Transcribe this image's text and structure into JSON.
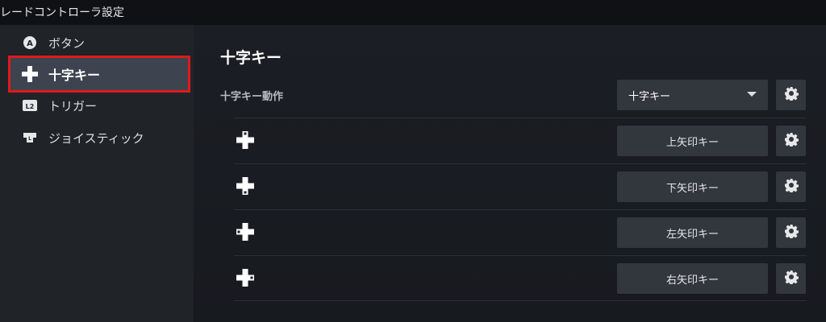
{
  "header": {
    "title": "レードコントローラ設定"
  },
  "sidebar": {
    "items": [
      {
        "label": "ボタン",
        "icon": "a-button-icon"
      },
      {
        "label": "十字キー",
        "icon": "dpad-icon",
        "active": true
      },
      {
        "label": "トリガー",
        "icon": "l2-trigger-icon"
      },
      {
        "label": "ジョイスティック",
        "icon": "joystick-icon"
      }
    ]
  },
  "main": {
    "section_title": "十字キー",
    "action_label": "十字キー動作",
    "action_select": {
      "value": "十字キー"
    },
    "rows": [
      {
        "direction": "up",
        "label": "上矢印キー"
      },
      {
        "direction": "down",
        "label": "下矢印キー"
      },
      {
        "direction": "left",
        "label": "左矢印キー"
      },
      {
        "direction": "right",
        "label": "右矢印キー"
      }
    ]
  },
  "colors": {
    "accent_highlight": "#e01a1a",
    "panel": "#32363d",
    "sidebar_bg": "#202328",
    "main_bg": "#1b1e24"
  }
}
